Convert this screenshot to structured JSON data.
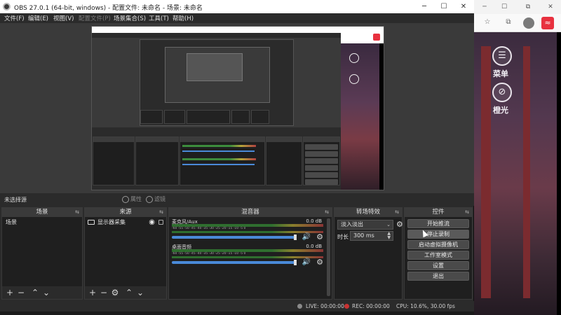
{
  "window": {
    "title": "OBS 27.0.1 (64-bit, windows) - 配置文件: 未命名 - 场景: 未命名",
    "minimize": "─",
    "maximize": "☐",
    "close": "✕"
  },
  "menu": {
    "file": "文件(F)",
    "edit": "编辑(E)",
    "view": "视图(V)",
    "profile": "配置文件(P)",
    "scene_collection": "场景集合(S)",
    "tools": "工具(T)",
    "help": "帮助(H)"
  },
  "bg_browser": {
    "menu_label": "菜单",
    "light_label": "橙光",
    "menu_icon_glyph": "☰",
    "light_icon_glyph": "⊘"
  },
  "preview_header": {
    "no_source": "未选择源",
    "properties": "属性",
    "filters": "滤镜"
  },
  "docks": {
    "scenes": {
      "title": "场景",
      "items": [
        "场景"
      ]
    },
    "sources": {
      "title": "来源",
      "items": [
        {
          "label": "显示器采集"
        }
      ]
    },
    "mixer": {
      "title": "混音器",
      "ticks": "-60 -55 -50 -45 -40 -35 -30 -25 -20 -15 -10 -5 0",
      "tracks": [
        {
          "name": "麦克风/Aux",
          "db": "0.0 dB"
        },
        {
          "name": "桌面音频",
          "db": "0.0 dB"
        }
      ]
    },
    "transitions": {
      "title": "转场特效",
      "selected": "淡入淡出",
      "duration_label": "时长",
      "duration_value": "300 ms"
    },
    "controls": {
      "title": "控件",
      "buttons": [
        "开始推流",
        "停止录制",
        "启动虚拟摄像机",
        "工作室模式",
        "设置",
        "退出"
      ]
    }
  },
  "statusbar": {
    "live": "LIVE: 00:00:00",
    "rec": "REC: 00:00:00",
    "cpu": "CPU: 10.6%, 30.00 fps"
  },
  "colors": {
    "rec_dot": "#c83232",
    "live_icon": "#8a8a8a",
    "accent_blue": "#4a8ad8"
  }
}
